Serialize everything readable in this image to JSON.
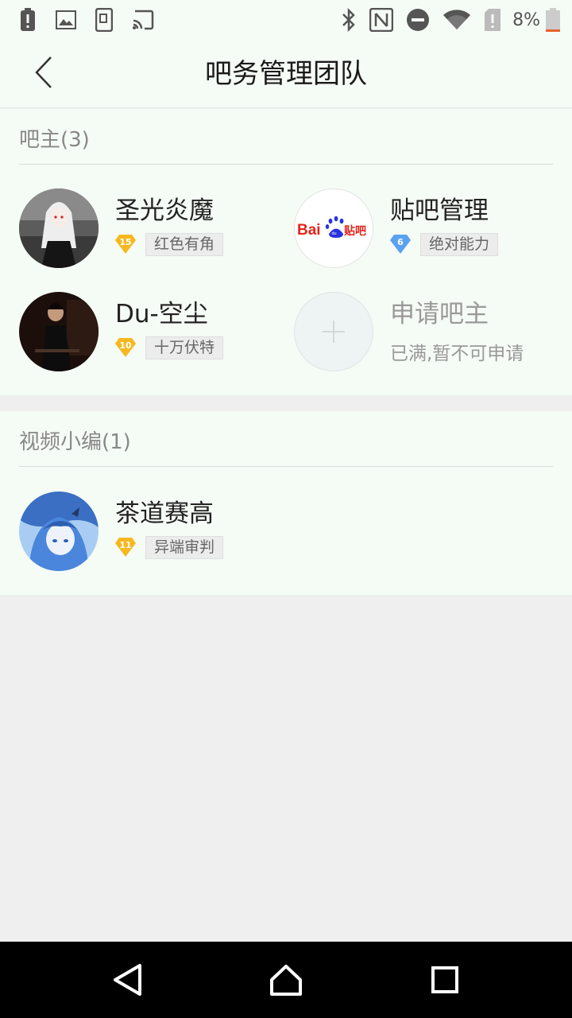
{
  "status_bar": {
    "battery_percent": "8%",
    "left_icons": [
      "battery-alert-icon",
      "image-icon",
      "screenshot-icon",
      "cast-icon"
    ],
    "right_icons": [
      "bluetooth-icon",
      "nfc-icon",
      "do-not-disturb-icon",
      "wifi-icon",
      "sim-alert-icon",
      "battery-icon"
    ]
  },
  "header": {
    "title": "吧务管理团队",
    "back_icon": "chevron-left-icon"
  },
  "owners": {
    "heading": "吧主(3)",
    "members": [
      {
        "name": "圣光炎魔",
        "level": "15",
        "title": "红色有角",
        "badge_color": "#f5b81f"
      },
      {
        "name": "贴吧管理",
        "level": "6",
        "title": "绝对能力",
        "badge_color": "#5aa2f0"
      },
      {
        "name": "Du-空尘",
        "level": "10",
        "title": "十万伏特",
        "badge_color": "#f5b81f"
      }
    ],
    "apply": {
      "name": "申请吧主",
      "status": "已满,暂不可申请"
    }
  },
  "video_editors": {
    "heading": "视频小编(1)",
    "members": [
      {
        "name": "茶道赛高",
        "level": "11",
        "title": "异端审判",
        "badge_color": "#f5b81f"
      }
    ]
  },
  "baidu_logo": {
    "text_bai": "Bai",
    "text_du": "du",
    "text_tieba": "贴吧",
    "brand_red": "#e1251b",
    "brand_blue": "#2932e1"
  },
  "nav_bar": {
    "buttons": [
      "back-triangle-icon",
      "home-icon",
      "recents-icon"
    ]
  }
}
